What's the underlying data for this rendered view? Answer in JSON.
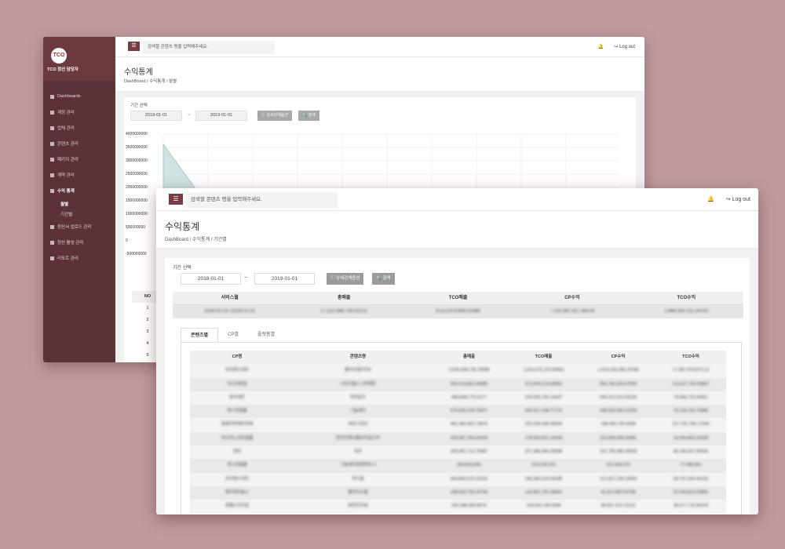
{
  "back": {
    "brand": "TCO 정산 담당자",
    "logo_text": "TCO",
    "menu": [
      {
        "label": "Dashboards",
        "active": false
      },
      {
        "label": "계정 관리",
        "active": false
      },
      {
        "label": "업체 관리",
        "active": false
      },
      {
        "label": "콘텐츠 관리",
        "active": false
      },
      {
        "label": "패키지 관리",
        "active": false
      },
      {
        "label": "계약 관리",
        "active": false
      },
      {
        "label": "수익 통계",
        "active": true
      }
    ],
    "submenu": [
      "월별",
      "기간별"
    ],
    "menu2": [
      "정산서 업로드 관리",
      "정산 활성 관리",
      "리포트 관리"
    ],
    "search_placeholder": "검색할 콘텐츠 명을 입력해주세요.",
    "logout": "Log out",
    "title": "수익통계",
    "crumb": "DashBoard  /  수익통계  /  월별",
    "period_label": "기간 선택",
    "date_from": "2018-01-01",
    "date_to": "2019-01-01",
    "tilde": "~",
    "btn_detail": "상세검색옵션",
    "btn_search": "검색",
    "yticks": [
      "4000000000",
      "3500000000",
      "3000000000",
      "2500000000",
      "2000000000",
      "1500000000",
      "1000000000",
      "500000000",
      "0",
      "-500000000"
    ],
    "table_header": "NO",
    "table_rows": [
      "1",
      "2",
      "3",
      "4",
      "5"
    ]
  },
  "front": {
    "search_placeholder": "검색할 콘텐츠 명을 입력해주세요.",
    "logout": "Log out",
    "title": "수익통계",
    "crumb": "DashBoard  /  수익통계  /  기간별",
    "period_label": "기간 선택",
    "date_from": "2018-01-01",
    "date_to": "2019-01-01",
    "tilde": "~",
    "btn_detail": "상세검색옵션",
    "btn_search": "검색",
    "summary_headers": [
      "서비스월",
      "총매출",
      "TCO매출",
      "CP수익",
      "TCO수익"
    ],
    "summary_row": [
      "2018-01-01~2019-01-01",
      "17,222,566,740.02212",
      "9,312,876,606.25484",
      "7,102,487,627.85478",
      "2,469,391,011.54791"
    ],
    "tabs": [
      "콘텐츠별",
      "CP별",
      "플랫폼별"
    ],
    "table_headers": [
      "CP명",
      "콘텐츠명",
      "총매출",
      "TCO매출",
      "CP수익",
      "TCO수익"
    ],
    "table_rows": [
      [
        "조이맨스네트",
        "블라이빌리지5",
        "2,535,608,735.78998",
        "1,031,675,276.54653",
        "1,014,332,280.47438",
        "17,397,979,873.13"
      ],
      [
        "미디어파일",
        "나의가홈스-2부제한",
        "905,414,802.64980",
        "473,044,114.83681",
        "259,746,329.07956",
        "113,627,755.05897"
      ],
      [
        "준비네트",
        "히어로즈",
        "883,848,776.4177",
        "229,035,795.14447",
        "245,915,910.59136",
        "74,084,725.44561"
      ],
      [
        "한나진월롭",
        "그늘세다",
        "575,645,478.79477",
        "344,417,239.77175",
        "248,293,035.01293",
        "78,134,193.79988"
      ],
      [
        "원설하마에빈안에",
        "외로나진단",
        "491,484,462.73875",
        "322,035,949.48434",
        "198,463,793.4498",
        "127,791,784.17549"
      ],
      [
        "미디어노르토필롭",
        "방전안에서돌려주실드부",
        "359,987,394.04204",
        "178,950,821.44328",
        "102,958,958.41881",
        "14,064,862.02838"
      ],
      [
        "한반",
        "포르",
        "369,481,713.75987",
        "227,986,084.39698",
        "147,795,486.99559",
        "80,196,597.95004"
      ],
      [
        "한나진월롭",
        "그늘세다방엔파트나",
        "354,823,055",
        "218,218,220",
        "141,606,222",
        "77,499,991"
      ],
      [
        "조이맨스네트",
        "마드을",
        "304,895,670.33132",
        "180,383,624.55398",
        "121,657,228.19655",
        "58,747,094.45135"
      ],
      [
        "에이캐치놀스",
        "블라이스릴",
        "238,594,756.26795",
        "143,061,701.58462",
        "91,017,882.54798",
        "52,043,819.03896"
      ],
      [
        "엔젤스미인립",
        "방전안의섬",
        "202,688,390.8079",
        "118,420,190.5938",
        "98,957,473.72113",
        "38,477,716.96478"
      ]
    ]
  }
}
